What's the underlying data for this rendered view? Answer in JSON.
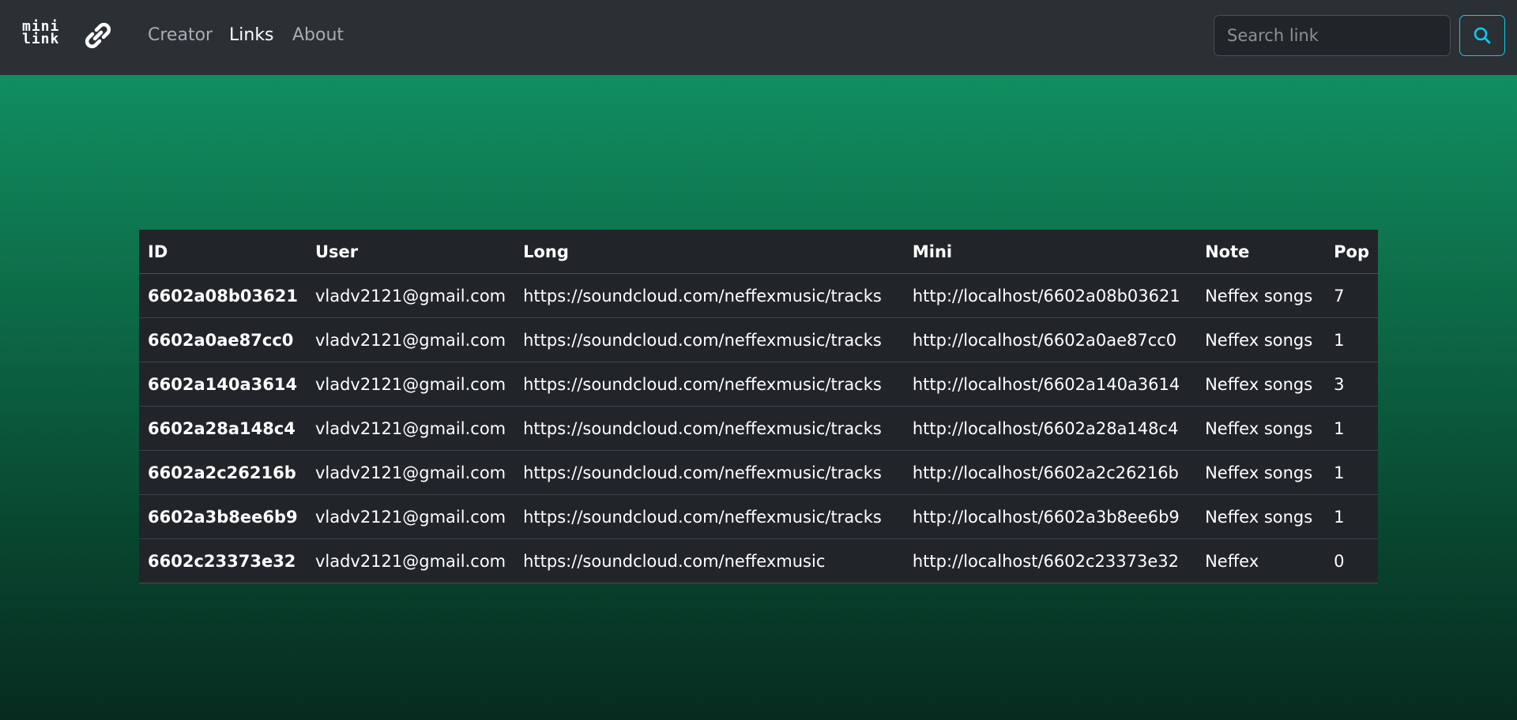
{
  "brand": {
    "line1": "mini",
    "line2": "link"
  },
  "nav": {
    "creator": "Creator",
    "links": "Links",
    "about": "About"
  },
  "search": {
    "placeholder": "Search link",
    "value": "",
    "button_icon": "search-icon",
    "accent": "#0dcaf0"
  },
  "table": {
    "headers": [
      "ID",
      "User",
      "Long",
      "Mini",
      "Note",
      "Pop"
    ],
    "rows": [
      [
        "6602a08b03621",
        "vladv2121@gmail.com",
        "https://soundcloud.com/neffexmusic/tracks",
        "http://localhost/6602a08b03621",
        "Neffex songs",
        "7"
      ],
      [
        "6602a0ae87cc0",
        "vladv2121@gmail.com",
        "https://soundcloud.com/neffexmusic/tracks",
        "http://localhost/6602a0ae87cc0",
        "Neffex songs",
        "1"
      ],
      [
        "6602a140a3614",
        "vladv2121@gmail.com",
        "https://soundcloud.com/neffexmusic/tracks",
        "http://localhost/6602a140a3614",
        "Neffex songs",
        "3"
      ],
      [
        "6602a28a148c4",
        "vladv2121@gmail.com",
        "https://soundcloud.com/neffexmusic/tracks",
        "http://localhost/6602a28a148c4",
        "Neffex songs",
        "1"
      ],
      [
        "6602a2c26216b",
        "vladv2121@gmail.com",
        "https://soundcloud.com/neffexmusic/tracks",
        "http://localhost/6602a2c26216b",
        "Neffex songs",
        "1"
      ],
      [
        "6602a3b8ee6b9",
        "vladv2121@gmail.com",
        "https://soundcloud.com/neffexmusic/tracks",
        "http://localhost/6602a3b8ee6b9",
        "Neffex songs",
        "1"
      ],
      [
        "6602c23373e32",
        "vladv2121@gmail.com",
        "https://soundcloud.com/neffexmusic",
        "http://localhost/6602c23373e32",
        "Neffex",
        "0"
      ]
    ]
  },
  "colors": {
    "navbar": "#2b3035",
    "table_bg": "#212529",
    "gradient_top": "#129a69",
    "gradient_bottom": "#072b1f"
  }
}
